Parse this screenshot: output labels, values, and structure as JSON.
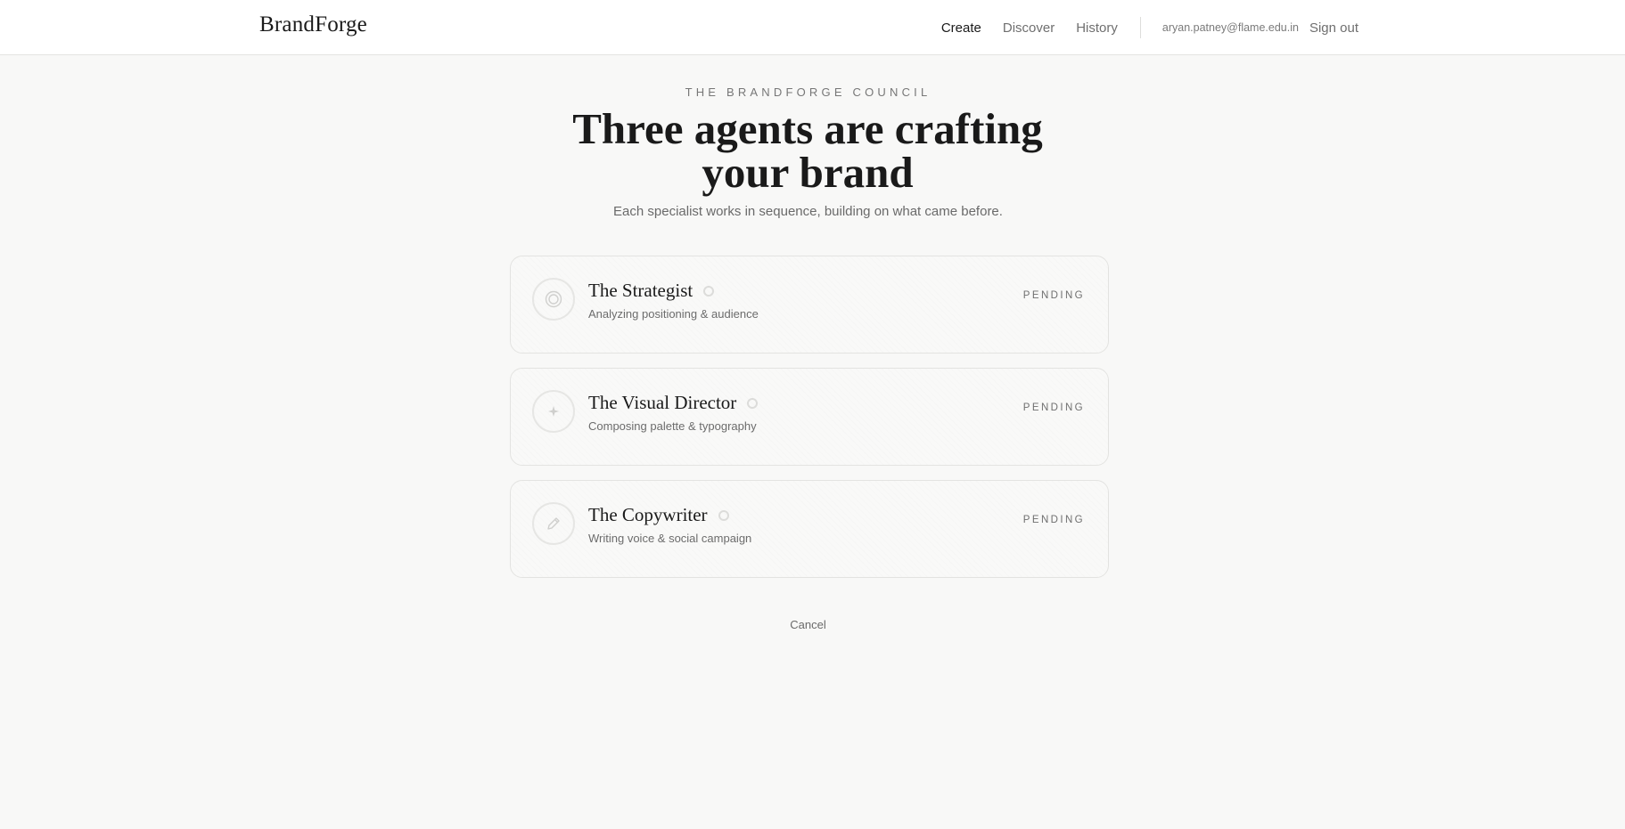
{
  "header": {
    "brand": "BrandForge",
    "nav": [
      {
        "label": "Create",
        "active": true
      },
      {
        "label": "Discover",
        "active": false
      },
      {
        "label": "History",
        "active": false
      }
    ],
    "user_email": "aryan.patney@flame.edu.in",
    "sign_out_label": "Sign out"
  },
  "hero": {
    "eyebrow": "THE BRANDFORGE COUNCIL",
    "title": "Three agents are crafting your brand",
    "subtitle": "Each specialist works in sequence, building on what came before."
  },
  "agents": [
    {
      "name": "The Strategist",
      "description": "Analyzing positioning & audience",
      "status": "PENDING",
      "icon": "target-icon"
    },
    {
      "name": "The Visual Director",
      "description": "Composing palette & typography",
      "status": "PENDING",
      "icon": "sparkle-icon"
    },
    {
      "name": "The Copywriter",
      "description": "Writing voice & social campaign",
      "status": "PENDING",
      "icon": "pencil-icon"
    }
  ],
  "actions": {
    "cancel_label": "Cancel"
  },
  "colors": {
    "background": "#f8f8f7",
    "header_background": "#ffffff",
    "text_primary": "#1a1a1a",
    "text_muted": "#6f6f6f",
    "border": "#e3e3e1"
  }
}
